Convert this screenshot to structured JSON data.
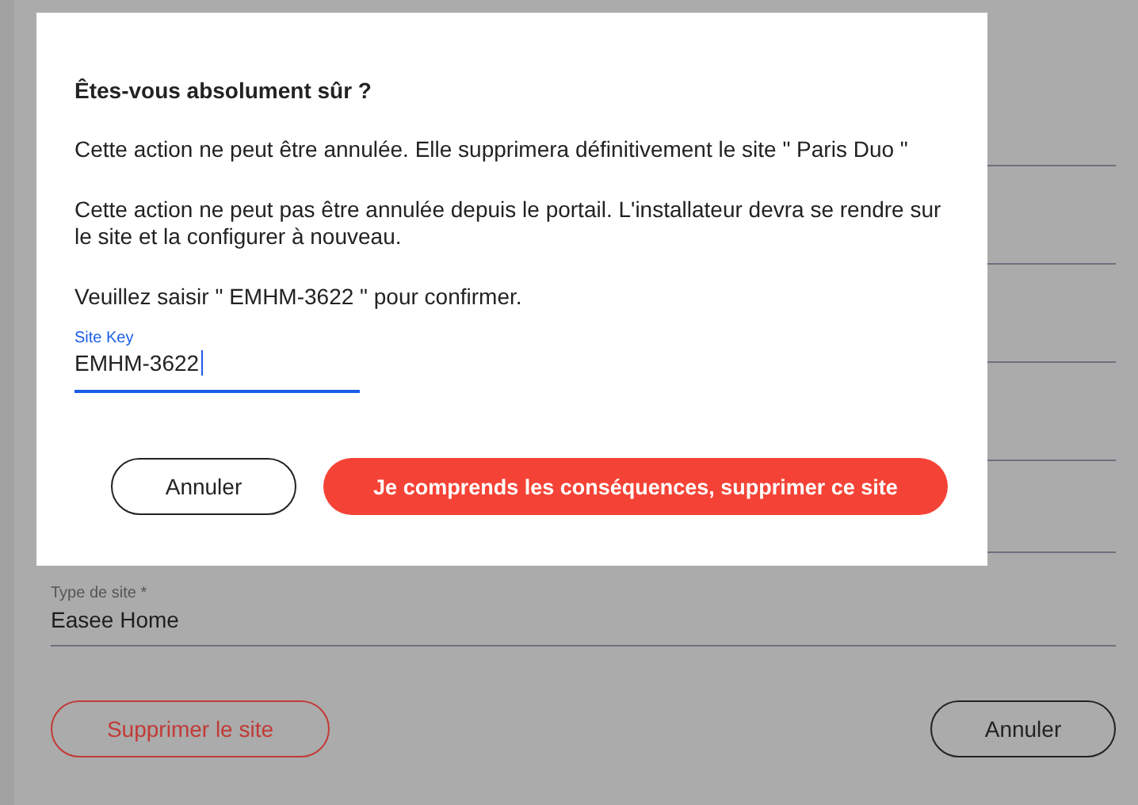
{
  "page": {
    "site_type_field": {
      "label": "Type de site *",
      "value": "Easee Home"
    },
    "buttons": [
      {
        "kind": "danger",
        "label": "Supprimer le site"
      },
      {
        "kind": "plain",
        "label": "Annuler"
      }
    ]
  },
  "dialog": {
    "title": "Êtes-vous absolument sûr ?",
    "paragraphs": [
      "Cette action ne peut être annulée. Elle supprimera définitivement le site \" Paris Duo \"",
      "Cette action ne peut pas être annulée depuis le portail. L'installateur devra se rendre sur le site et la configurer à nouveau.",
      "Veuillez saisir \" EMHM-3622 \" pour confirmer."
    ],
    "field": {
      "label": "Site Key",
      "value": "EMHM-3622"
    },
    "buttons": [
      {
        "kind": "plain",
        "label": "Annuler"
      },
      {
        "kind": "primary",
        "label": "Je comprends les conséquences, supprimer ce site"
      }
    ]
  }
}
